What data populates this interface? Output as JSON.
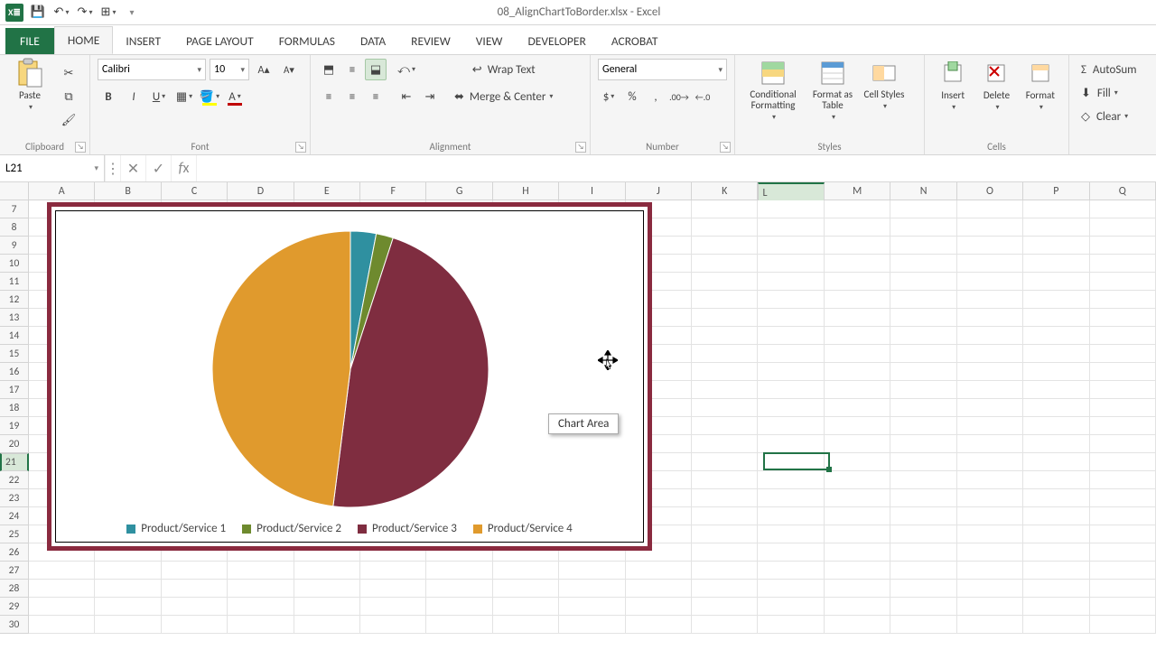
{
  "app": {
    "title": "08_AlignChartToBorder.xlsx - Excel"
  },
  "ribbon": {
    "tabs": {
      "file": "FILE",
      "home": "HOME",
      "insert": "INSERT",
      "page_layout": "PAGE LAYOUT",
      "formulas": "FORMULAS",
      "data": "DATA",
      "review": "REVIEW",
      "view": "VIEW",
      "developer": "DEVELOPER",
      "acrobat": "ACROBAT"
    },
    "clipboard": {
      "label": "Clipboard",
      "paste": "Paste"
    },
    "font": {
      "label": "Font",
      "family": "Calibri",
      "size": "10"
    },
    "alignment": {
      "label": "Alignment",
      "wrap": "Wrap Text",
      "merge": "Merge & Center"
    },
    "number": {
      "label": "Number",
      "format": "General"
    },
    "styles": {
      "label": "Styles",
      "cond": "Conditional Formatting",
      "fat": "Format as Table",
      "cstyles": "Cell Styles"
    },
    "cells": {
      "label": "Cells",
      "insert": "Insert",
      "delete": "Delete",
      "format": "Format"
    },
    "editing": {
      "autosum": "AutoSum",
      "fill": "Fill",
      "clear": "Clear"
    }
  },
  "formula_bar": {
    "name_box": "L21",
    "formula": ""
  },
  "grid": {
    "columns": [
      "A",
      "B",
      "C",
      "D",
      "E",
      "F",
      "G",
      "H",
      "I",
      "J",
      "K",
      "L",
      "M",
      "N",
      "O",
      "P",
      "Q"
    ],
    "first_row": 7,
    "last_row": 30,
    "active_col": "L",
    "active_row": 21
  },
  "chart_tooltip": "Chart Area",
  "chart_data": {
    "type": "pie",
    "title": "",
    "series_name": "",
    "categories": [
      "Product/Service 1",
      "Product/Service 2",
      "Product/Service 3",
      "Product/Service 4"
    ],
    "values": [
      3,
      2,
      47,
      48
    ],
    "colors": [
      "#2f90a0",
      "#6e8a2e",
      "#7f2d40",
      "#e09a2d"
    ],
    "legend_position": "bottom",
    "start_angle_deg": 0
  }
}
